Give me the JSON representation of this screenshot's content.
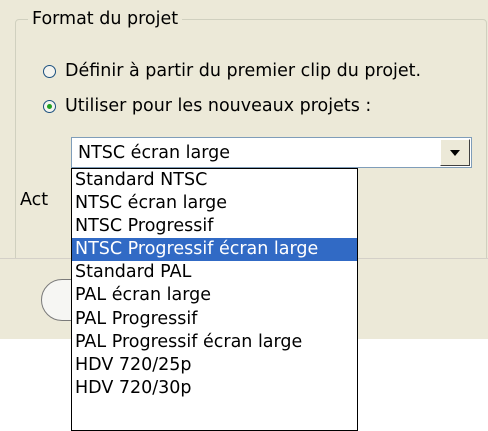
{
  "group": {
    "title": "Format du projet"
  },
  "options": [
    {
      "label": "Définir à partir du premier clip du projet.",
      "checked": false
    },
    {
      "label": "Utiliser pour les nouveaux projets :",
      "checked": true
    }
  ],
  "format_combo": {
    "value": "NTSC écran large"
  },
  "partial_label": "Act",
  "dropdown": {
    "items": [
      "Standard NTSC",
      "NTSC écran large",
      "NTSC Progressif",
      "NTSC Progressif écran large",
      "Standard PAL",
      "PAL écran large",
      "PAL Progressif",
      "PAL Progressif écran large",
      "HDV 720/25p",
      "HDV 720/30p"
    ],
    "highlighted": "NTSC Progressif écran large"
  },
  "colors": {
    "highlight": "#316ac5",
    "dialog_bg": "#ece9d8",
    "radio_dot": "#21a121"
  }
}
